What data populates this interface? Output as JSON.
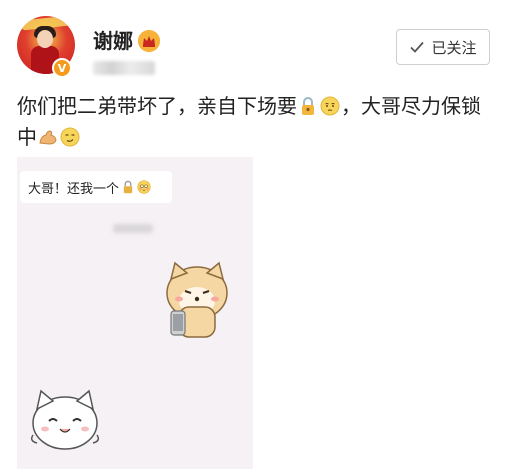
{
  "user": {
    "name": "谢娜",
    "verified_badge": "V",
    "crown_icon": "crown-icon"
  },
  "follow_button": {
    "label": "已关注",
    "icon": "check-icon"
  },
  "post": {
    "text_1": "你们把二弟带坏了，亲自下场要",
    "text_2": "，大哥尽力保锁中",
    "emojis": [
      "lock-icon",
      "pensive-face-icon",
      "flexed-bicep-icon",
      "smirk-face-icon"
    ]
  },
  "image": {
    "bubble_text": "大哥！还我一个",
    "bubble_emojis": [
      "lock-icon",
      "flushed-face-icon"
    ]
  },
  "colors": {
    "accent": "#f59a1c",
    "image_bg": "#f6f1f4",
    "button_border": "#cfcfcf"
  }
}
